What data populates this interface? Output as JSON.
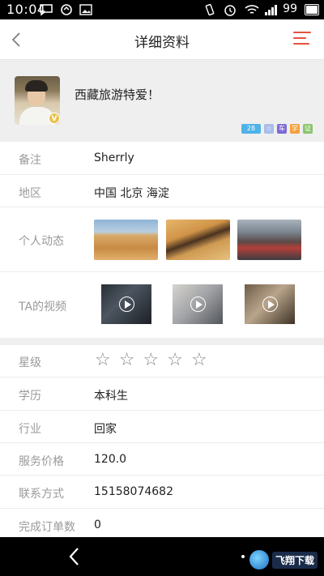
{
  "status_bar": {
    "time": "10:04",
    "battery": "99",
    "icons": [
      "notification-app-icon",
      "message-icon",
      "sync-icon",
      "image-icon",
      "vibrate-icon",
      "alarm-icon",
      "wifi-icon",
      "signal-icon",
      "battery-icon"
    ]
  },
  "header": {
    "title": "详细资料",
    "back_icon": "chevron-left-icon",
    "menu_icon": "menu-lines-icon",
    "accent_color": "#e5533d"
  },
  "profile": {
    "signature": "西藏旅游特爱！",
    "verified_badge": "V",
    "badges": [
      "28",
      "☆",
      "车",
      "学",
      "证"
    ]
  },
  "fields": {
    "note_label": "备注",
    "note_value": "Sherrly",
    "region_label": "地区",
    "region_value": "中国 北京 海淀",
    "moments_label": "个人动态",
    "videos_label": "TA的视频",
    "rating_label": "星级",
    "rating_value": 0,
    "rating_max": 5,
    "education_label": "学历",
    "education_value": "本科生",
    "industry_label": "行业",
    "industry_value": "回家",
    "price_label": "服务价格",
    "price_value": "120.0",
    "contact_label": "联系方式",
    "contact_value": "15158074682",
    "orders_label": "完成订单数",
    "orders_value": "0"
  },
  "nav_bar": {
    "back_icon": "nav-back-icon",
    "watermark": "飞翔下载"
  }
}
